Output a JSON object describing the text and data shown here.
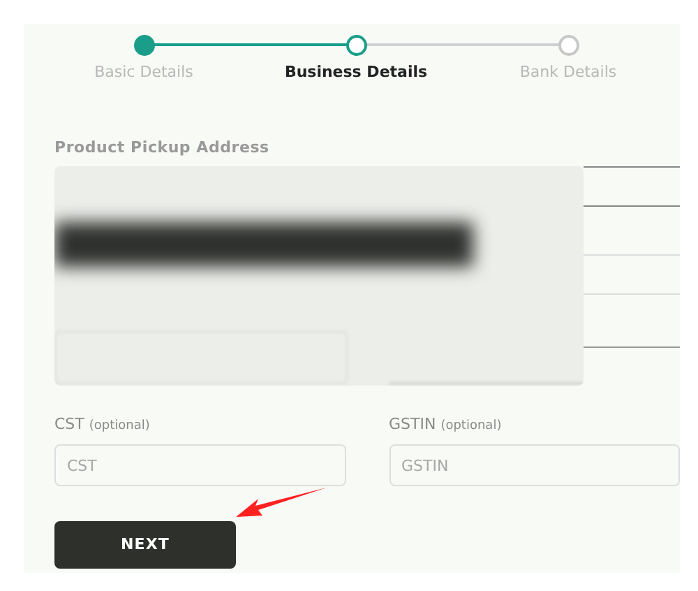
{
  "steps": [
    {
      "label": "Basic Details",
      "completed": true,
      "selected": false
    },
    {
      "label": "Business Details",
      "completed": false,
      "selected": true
    },
    {
      "label": "Bank Details",
      "completed": false,
      "selected": false
    }
  ],
  "section_title": "Product Pickup Address",
  "fields": [
    {
      "label": "CST",
      "hint": "(optional)",
      "placeholder": "CST"
    },
    {
      "label": "GSTIN",
      "hint": "(optional)",
      "placeholder": "GSTIN"
    }
  ],
  "next_button": "NEXT"
}
